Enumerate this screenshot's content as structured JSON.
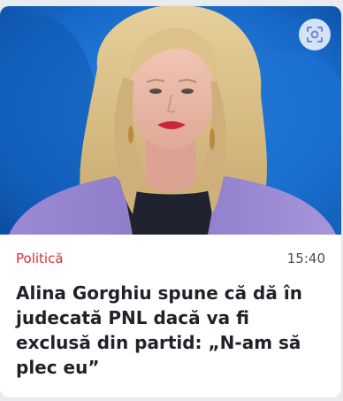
{
  "article": {
    "category": "Politică",
    "time": "15:40",
    "headline": "Alina Gorghiu spune că dă în judecată PNL dacă va fi exclusă din partid: „N-am să plec eu”"
  },
  "image_action": {
    "icon": "lens-search-icon"
  },
  "colors": {
    "category": "#d4312e",
    "image_background": "#1769c9",
    "jacket": "#8e7bc9"
  }
}
